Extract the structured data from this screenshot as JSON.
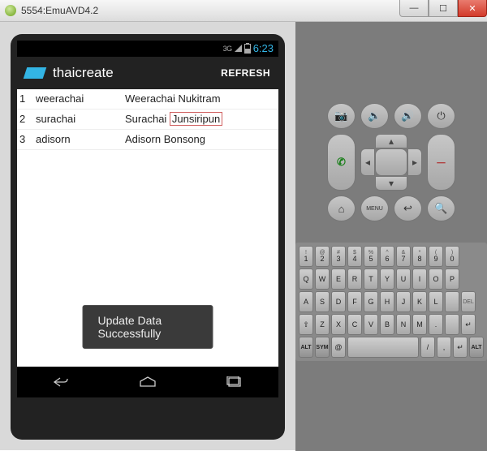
{
  "window": {
    "title": "5554:EmuAVD4.2"
  },
  "statusbar": {
    "net": "3G",
    "time": "6:23"
  },
  "actionbar": {
    "title": "thaicreate",
    "refresh": "REFRESH"
  },
  "rows": [
    {
      "id": "1",
      "user": "weerachai",
      "name_a": "Weerachai Nukitram",
      "name_b": ""
    },
    {
      "id": "2",
      "user": "surachai",
      "name_a": "Surachai ",
      "name_b": "Junsiripun"
    },
    {
      "id": "3",
      "user": "adisorn",
      "name_a": "Adisorn Bonsong",
      "name_b": ""
    }
  ],
  "toast": "Update Data Successfully",
  "ctrl": {
    "menu": "MENU",
    "alt": "ALT",
    "sym": "SYM",
    "del": "DEL"
  },
  "kbd": {
    "r1s": [
      "!",
      "@",
      "#",
      "$",
      "%",
      "^",
      "&",
      "*",
      "(",
      ")"
    ],
    "r1": [
      "1",
      "2",
      "3",
      "4",
      "5",
      "6",
      "7",
      "8",
      "9",
      "0"
    ],
    "r2": [
      "Q",
      "W",
      "E",
      "R",
      "T",
      "Y",
      "U",
      "I",
      "O",
      "P"
    ],
    "r3": [
      "A",
      "S",
      "D",
      "F",
      "G",
      "H",
      "J",
      "K",
      "L"
    ],
    "r4": [
      "Z",
      "X",
      "C",
      "V",
      "B",
      "N",
      "M",
      ".",
      ""
    ],
    "r5": [
      "@",
      "/",
      "",
      "",
      ",",
      "↵"
    ]
  }
}
